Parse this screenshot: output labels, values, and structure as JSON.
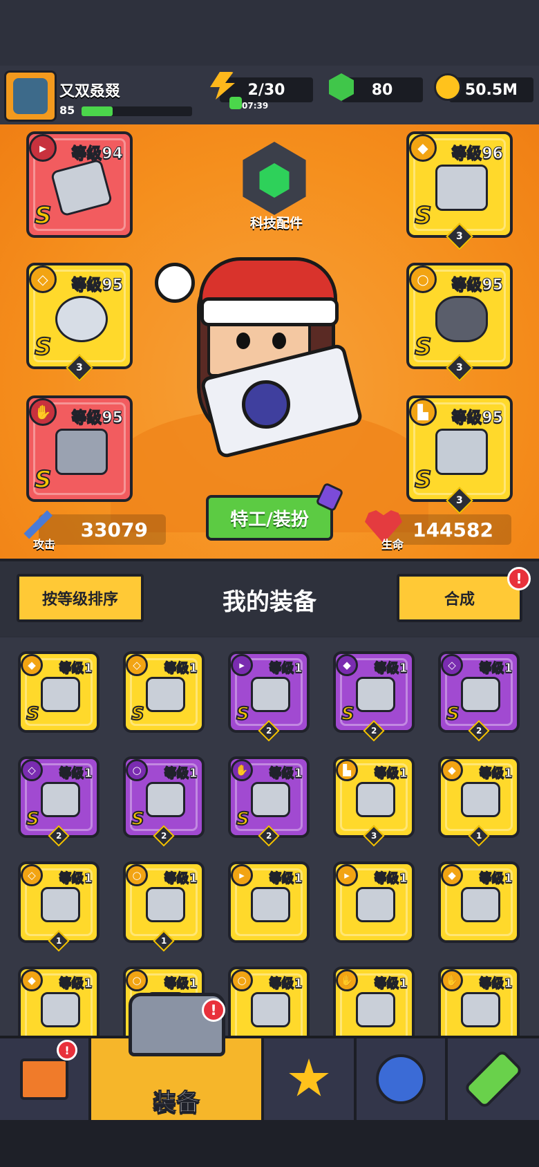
{
  "player": {
    "name": "又双叒叕",
    "level": "85",
    "xp_fraction": 0.28
  },
  "resources": {
    "energy": {
      "value": "2/30",
      "timer": "07:39",
      "icon": "lightning-icon"
    },
    "gems": {
      "value": "80",
      "icon": "green-gem-icon"
    },
    "coins": {
      "value": "50.5M",
      "icon": "gold-coin-icon"
    }
  },
  "equipped": {
    "weapon": {
      "level_label": "等级94",
      "grade": "S"
    },
    "armor": {
      "level_label": "等级96",
      "grade": "S",
      "stars": "3"
    },
    "necklace": {
      "level_label": "等级95",
      "grade": "S",
      "stars": "3"
    },
    "belt": {
      "level_label": "等级95",
      "grade": "S",
      "stars": "3"
    },
    "gloves": {
      "level_label": "等级95",
      "grade": "S"
    },
    "boots": {
      "level_label": "等级95",
      "grade": "S",
      "stars": "3"
    }
  },
  "tech": {
    "label": "科技配件"
  },
  "stats": {
    "attack": {
      "label": "攻击",
      "value": "33079"
    },
    "health": {
      "label": "生命",
      "value": "144582"
    }
  },
  "costume_button": "特工/装扮",
  "sort_button": "按等级排序",
  "inventory_title": "我的装备",
  "merge_button": "合成",
  "notification": "!",
  "inventory": [
    {
      "level": "等级1",
      "grade": "S",
      "color": "yellow",
      "type": "armor"
    },
    {
      "level": "等级1",
      "grade": "S",
      "color": "yellow",
      "type": "necklace"
    },
    {
      "level": "等级1",
      "grade": "S",
      "color": "purple",
      "type": "weapon",
      "stars": "2"
    },
    {
      "level": "等级1",
      "grade": "S",
      "color": "purple",
      "type": "armor",
      "stars": "2"
    },
    {
      "level": "等级1",
      "grade": "S",
      "color": "purple",
      "type": "necklace",
      "stars": "2"
    },
    {
      "level": "等级1",
      "grade": "S",
      "color": "purple",
      "type": "necklace",
      "stars": "2"
    },
    {
      "level": "等级1",
      "grade": "S",
      "color": "purple",
      "type": "belt",
      "stars": "2"
    },
    {
      "level": "等级1",
      "grade": "S",
      "color": "purple",
      "type": "gloves",
      "stars": "2"
    },
    {
      "level": "等级1",
      "grade": "",
      "color": "yellow",
      "type": "boots",
      "stars": "3"
    },
    {
      "level": "等级1",
      "grade": "",
      "color": "yellow",
      "type": "armor",
      "stars": "1"
    },
    {
      "level": "等级1",
      "grade": "",
      "color": "yellow",
      "type": "necklace",
      "stars": "1"
    },
    {
      "level": "等级1",
      "grade": "",
      "color": "yellow",
      "type": "belt",
      "stars": "1"
    },
    {
      "level": "等级1",
      "grade": "",
      "color": "yellow",
      "type": "weapon"
    },
    {
      "level": "等级1",
      "grade": "",
      "color": "yellow",
      "type": "weapon"
    },
    {
      "level": "等级1",
      "grade": "",
      "color": "yellow",
      "type": "armor"
    },
    {
      "level": "等级1",
      "grade": "",
      "color": "yellow",
      "type": "armor"
    },
    {
      "level": "等级1",
      "grade": "",
      "color": "yellow",
      "type": "belt"
    },
    {
      "level": "等级1",
      "grade": "",
      "color": "yellow",
      "type": "belt"
    },
    {
      "level": "等级1",
      "grade": "",
      "color": "yellow",
      "type": "gloves"
    },
    {
      "level": "等级1",
      "grade": "",
      "color": "yellow",
      "type": "gloves"
    }
  ],
  "nav": {
    "shop": {
      "icon": "shop-icon",
      "badge": "!"
    },
    "equip": {
      "label": "装备",
      "icon": "revolver-icon",
      "badge": "!"
    },
    "talent": {
      "icon": "star-swords-icon"
    },
    "evolve": {
      "icon": "stars-orb-icon"
    },
    "dna": {
      "icon": "dna-capsule-icon"
    }
  },
  "colors": {
    "accent": "#f6b62a",
    "red": "#f25c5f",
    "purple": "#a14ad1",
    "green": "#5ccb43"
  }
}
